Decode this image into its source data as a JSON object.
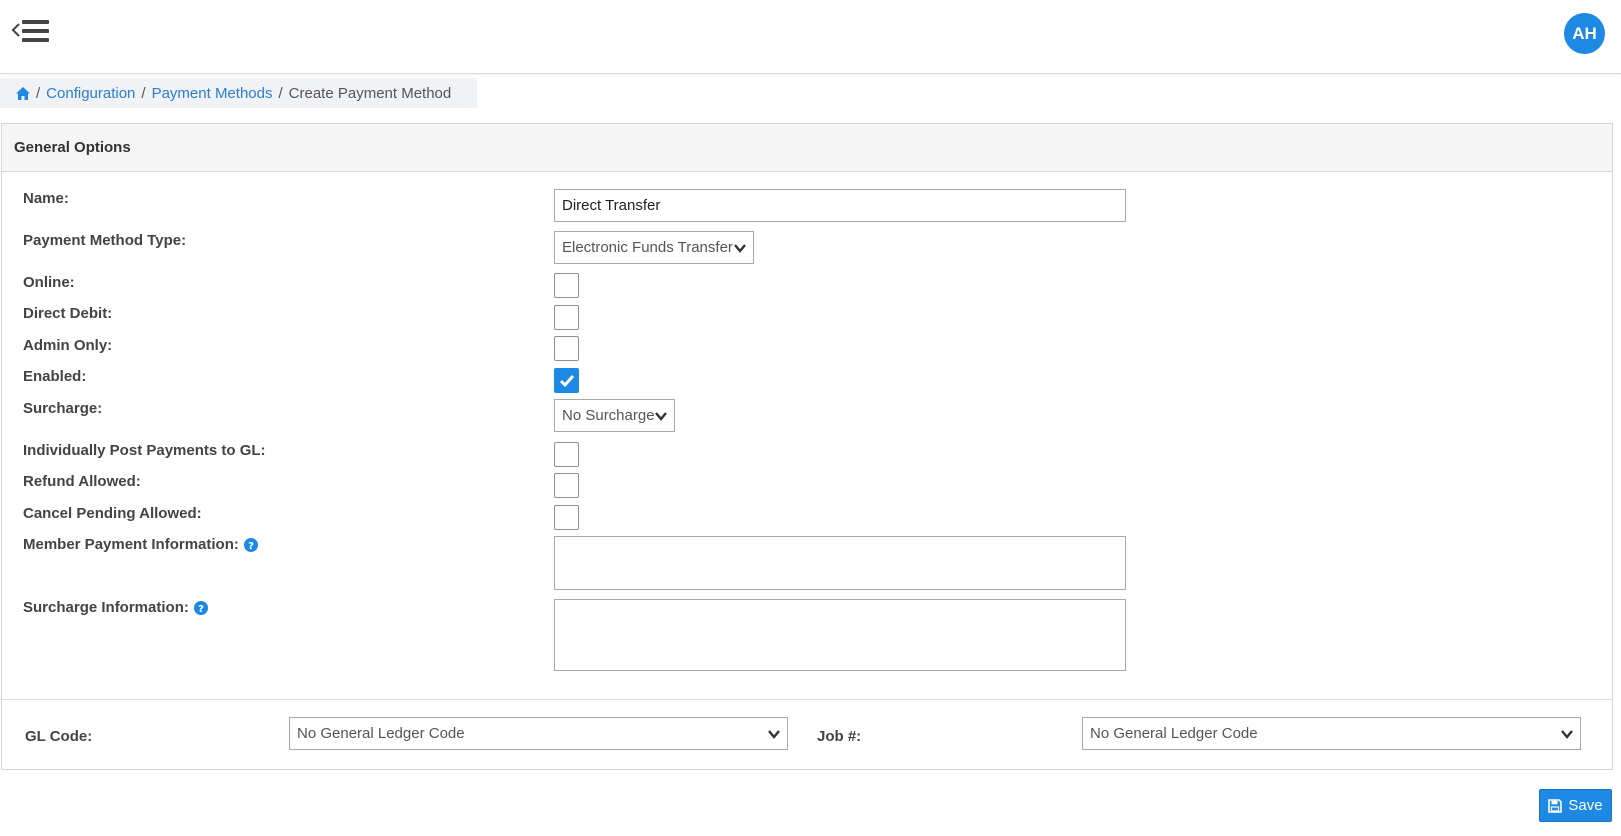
{
  "colors": {
    "accent": "#1e88e5",
    "link": "#2a7ed4",
    "icon_dark": "#333333"
  },
  "header": {
    "menu_icon": "menu-collapse-icon",
    "user_initials": "AH"
  },
  "breadcrumb": {
    "home_icon": "home-icon",
    "items": [
      "Configuration",
      "Payment Methods"
    ],
    "current": "Create Payment Method",
    "separator": "/"
  },
  "panel": {
    "title": "General Options"
  },
  "form": {
    "name": {
      "label": "Name:",
      "value": "Direct Transfer"
    },
    "payment_method_type": {
      "label": "Payment Method Type:",
      "value": "Electronic Funds Transfer"
    },
    "online": {
      "label": "Online:",
      "checked": false
    },
    "direct_debit": {
      "label": "Direct Debit:",
      "checked": false
    },
    "admin_only": {
      "label": "Admin Only:",
      "checked": false
    },
    "enabled": {
      "label": "Enabled:",
      "checked": true
    },
    "surcharge": {
      "label": "Surcharge:",
      "value": "No Surcharge"
    },
    "individually_post": {
      "label": "Individually Post Payments to GL:",
      "checked": false
    },
    "refund_allowed": {
      "label": "Refund Allowed:",
      "checked": false
    },
    "cancel_pending": {
      "label": "Cancel Pending Allowed:",
      "checked": false
    },
    "member_payment_info": {
      "label": "Member Payment Information:",
      "value": "",
      "help_icon": "question-circle-icon"
    },
    "surcharge_info": {
      "label": "Surcharge Information:",
      "value": "",
      "help_icon": "question-circle-icon"
    },
    "gl_code": {
      "label": "GL Code:",
      "value": "No General Ledger Code"
    },
    "job_number": {
      "label": "Job #:",
      "value": "No General Ledger Code"
    }
  },
  "actions": {
    "save_label": "Save",
    "save_icon": "floppy-disk-icon"
  }
}
